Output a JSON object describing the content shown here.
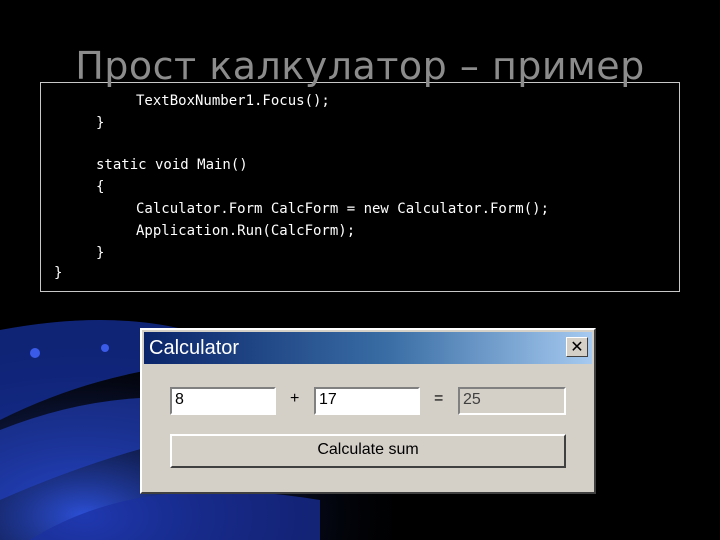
{
  "slide": {
    "title": "Прост калкулатор – пример"
  },
  "code": {
    "lines": [
      "TextBoxNumber1.Focus();",
      "}",
      "static void Main()",
      "{",
      "Calculator.Form CalcForm = new Calculator.Form();",
      "Application.Run(CalcForm);",
      "}",
      "}"
    ]
  },
  "dialog": {
    "title": "Calculator",
    "close_label": "✕",
    "number1_value": "8",
    "plus_sign": "+",
    "number2_value": "17",
    "equals_sign": "=",
    "result_value": "25",
    "calculate_label": "Calculate sum"
  },
  "colors": {
    "titlebar_start": "#0a246a",
    "titlebar_end": "#a6caf0",
    "dialog_face": "#d4d0c8"
  }
}
